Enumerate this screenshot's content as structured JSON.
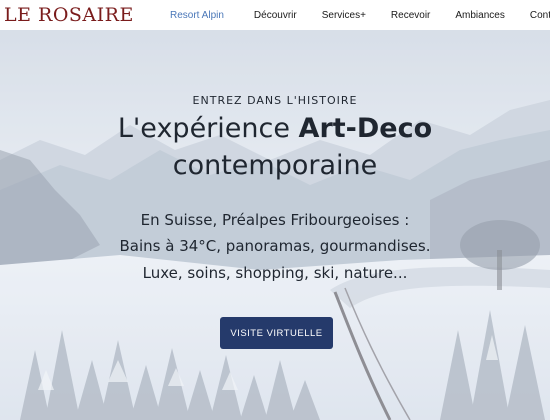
{
  "brand": {
    "name": "LE ROSAIRE"
  },
  "nav": {
    "items": [
      {
        "label": "Resort Alpin",
        "active": true
      },
      {
        "label": "Découvrir",
        "active": false
      },
      {
        "label": "Services+",
        "active": false
      },
      {
        "label": "Recevoir",
        "active": false
      },
      {
        "label": "Ambiances",
        "active": false
      },
      {
        "label": "Contact",
        "active": false
      }
    ]
  },
  "hero": {
    "eyebrow": "ENTREZ DANS L'HISTOIRE",
    "headline_line1_prefix": "L'expérience ",
    "headline_line1_bold": "Art-Deco",
    "headline_line2": "contemporaine",
    "sub_line1": "En Suisse, Préalpes Fribourgeoises :",
    "sub_line2": "Bains à 34°C, panoramas, gourmandises.",
    "sub_line3": "Luxe, soins, shopping, ski, nature...",
    "cta_label": "VISITE VIRTUELLE"
  },
  "colors": {
    "brand": "#7a1c1c",
    "nav_active": "#4a77b8",
    "cta_bg": "#253a6b",
    "text": "#1f2630"
  }
}
